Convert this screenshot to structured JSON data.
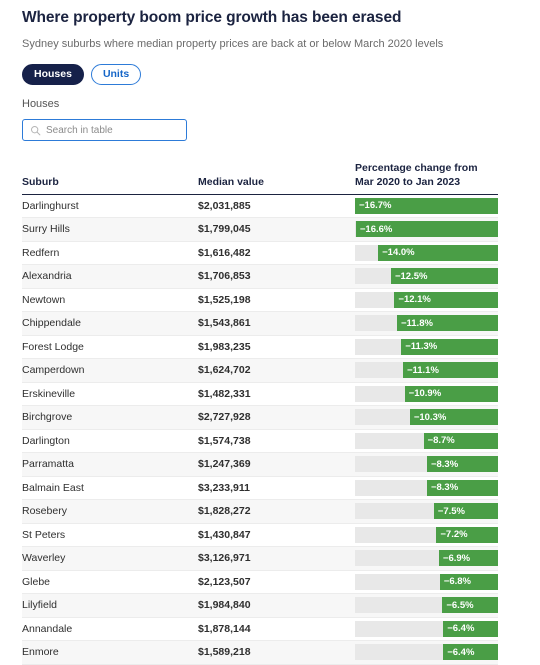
{
  "header": {
    "title": "Where property boom price growth has been erased",
    "subtitle": "Sydney suburbs where median property prices are back at or below March 2020 levels"
  },
  "toggle": {
    "houses_label": "Houses",
    "units_label": "Units",
    "active": "Houses",
    "active_bg": "#16214a",
    "inactive_color": "#1666c8"
  },
  "section_label": "Houses",
  "search": {
    "placeholder": "Search in table",
    "value": "",
    "icon": "search-icon"
  },
  "table": {
    "columns": {
      "suburb": "Suburb",
      "median": "Median value",
      "pct": "Percentage change from Mar 2020 to Jan 2023"
    },
    "bar_color": "#4a9e46",
    "track_color": "#e8e8e8"
  },
  "chart_data": {
    "type": "bar",
    "title": "Where property boom price growth has been erased",
    "subtitle": "Sydney suburbs where median property prices are back at or below March 2020 levels",
    "xlabel": "Percentage change from Mar 2020 to Jan 2023",
    "ylabel": "Suburb",
    "orientation": "horizontal",
    "grid": false,
    "legend": "none",
    "xlim": [
      -16.7,
      0
    ],
    "categories": [
      "Darlinghurst",
      "Surry Hills",
      "Redfern",
      "Alexandria",
      "Newtown",
      "Chippendale",
      "Forest Lodge",
      "Camperdown",
      "Erskineville",
      "Birchgrove",
      "Darlington",
      "Parramatta",
      "Balmain East",
      "Rosebery",
      "St Peters",
      "Waverley",
      "Glebe",
      "Lilyfield",
      "Annandale",
      "Enmore"
    ],
    "values": [
      -16.7,
      -16.6,
      -14.0,
      -12.5,
      -12.1,
      -11.8,
      -11.3,
      -11.1,
      -10.9,
      -10.3,
      -8.7,
      -8.3,
      -8.3,
      -7.5,
      -7.2,
      -6.9,
      -6.8,
      -6.5,
      -6.4,
      -6.4
    ],
    "rows": [
      {
        "suburb": "Darlinghurst",
        "median": "$2,031,885",
        "pct_label": "−16.7%",
        "pct": -16.7
      },
      {
        "suburb": "Surry Hills",
        "median": "$1,799,045",
        "pct_label": "−16.6%",
        "pct": -16.6
      },
      {
        "suburb": "Redfern",
        "median": "$1,616,482",
        "pct_label": "−14.0%",
        "pct": -14.0
      },
      {
        "suburb": "Alexandria",
        "median": "$1,706,853",
        "pct_label": "−12.5%",
        "pct": -12.5
      },
      {
        "suburb": "Newtown",
        "median": "$1,525,198",
        "pct_label": "−12.1%",
        "pct": -12.1
      },
      {
        "suburb": "Chippendale",
        "median": "$1,543,861",
        "pct_label": "−11.8%",
        "pct": -11.8
      },
      {
        "suburb": "Forest Lodge",
        "median": "$1,983,235",
        "pct_label": "−11.3%",
        "pct": -11.3
      },
      {
        "suburb": "Camperdown",
        "median": "$1,624,702",
        "pct_label": "−11.1%",
        "pct": -11.1
      },
      {
        "suburb": "Erskineville",
        "median": "$1,482,331",
        "pct_label": "−10.9%",
        "pct": -10.9
      },
      {
        "suburb": "Birchgrove",
        "median": "$2,727,928",
        "pct_label": "−10.3%",
        "pct": -10.3
      },
      {
        "suburb": "Darlington",
        "median": "$1,574,738",
        "pct_label": "−8.7%",
        "pct": -8.7
      },
      {
        "suburb": "Parramatta",
        "median": "$1,247,369",
        "pct_label": "−8.3%",
        "pct": -8.3
      },
      {
        "suburb": "Balmain East",
        "median": "$3,233,911",
        "pct_label": "−8.3%",
        "pct": -8.3
      },
      {
        "suburb": "Rosebery",
        "median": "$1,828,272",
        "pct_label": "−7.5%",
        "pct": -7.5
      },
      {
        "suburb": "St Peters",
        "median": "$1,430,847",
        "pct_label": "−7.2%",
        "pct": -7.2
      },
      {
        "suburb": "Waverley",
        "median": "$3,126,971",
        "pct_label": "−6.9%",
        "pct": -6.9
      },
      {
        "suburb": "Glebe",
        "median": "$2,123,507",
        "pct_label": "−6.8%",
        "pct": -6.8
      },
      {
        "suburb": "Lilyfield",
        "median": "$1,984,840",
        "pct_label": "−6.5%",
        "pct": -6.5
      },
      {
        "suburb": "Annandale",
        "median": "$1,878,144",
        "pct_label": "−6.4%",
        "pct": -6.4
      },
      {
        "suburb": "Enmore",
        "median": "$1,589,218",
        "pct_label": "−6.4%",
        "pct": -6.4
      }
    ]
  }
}
